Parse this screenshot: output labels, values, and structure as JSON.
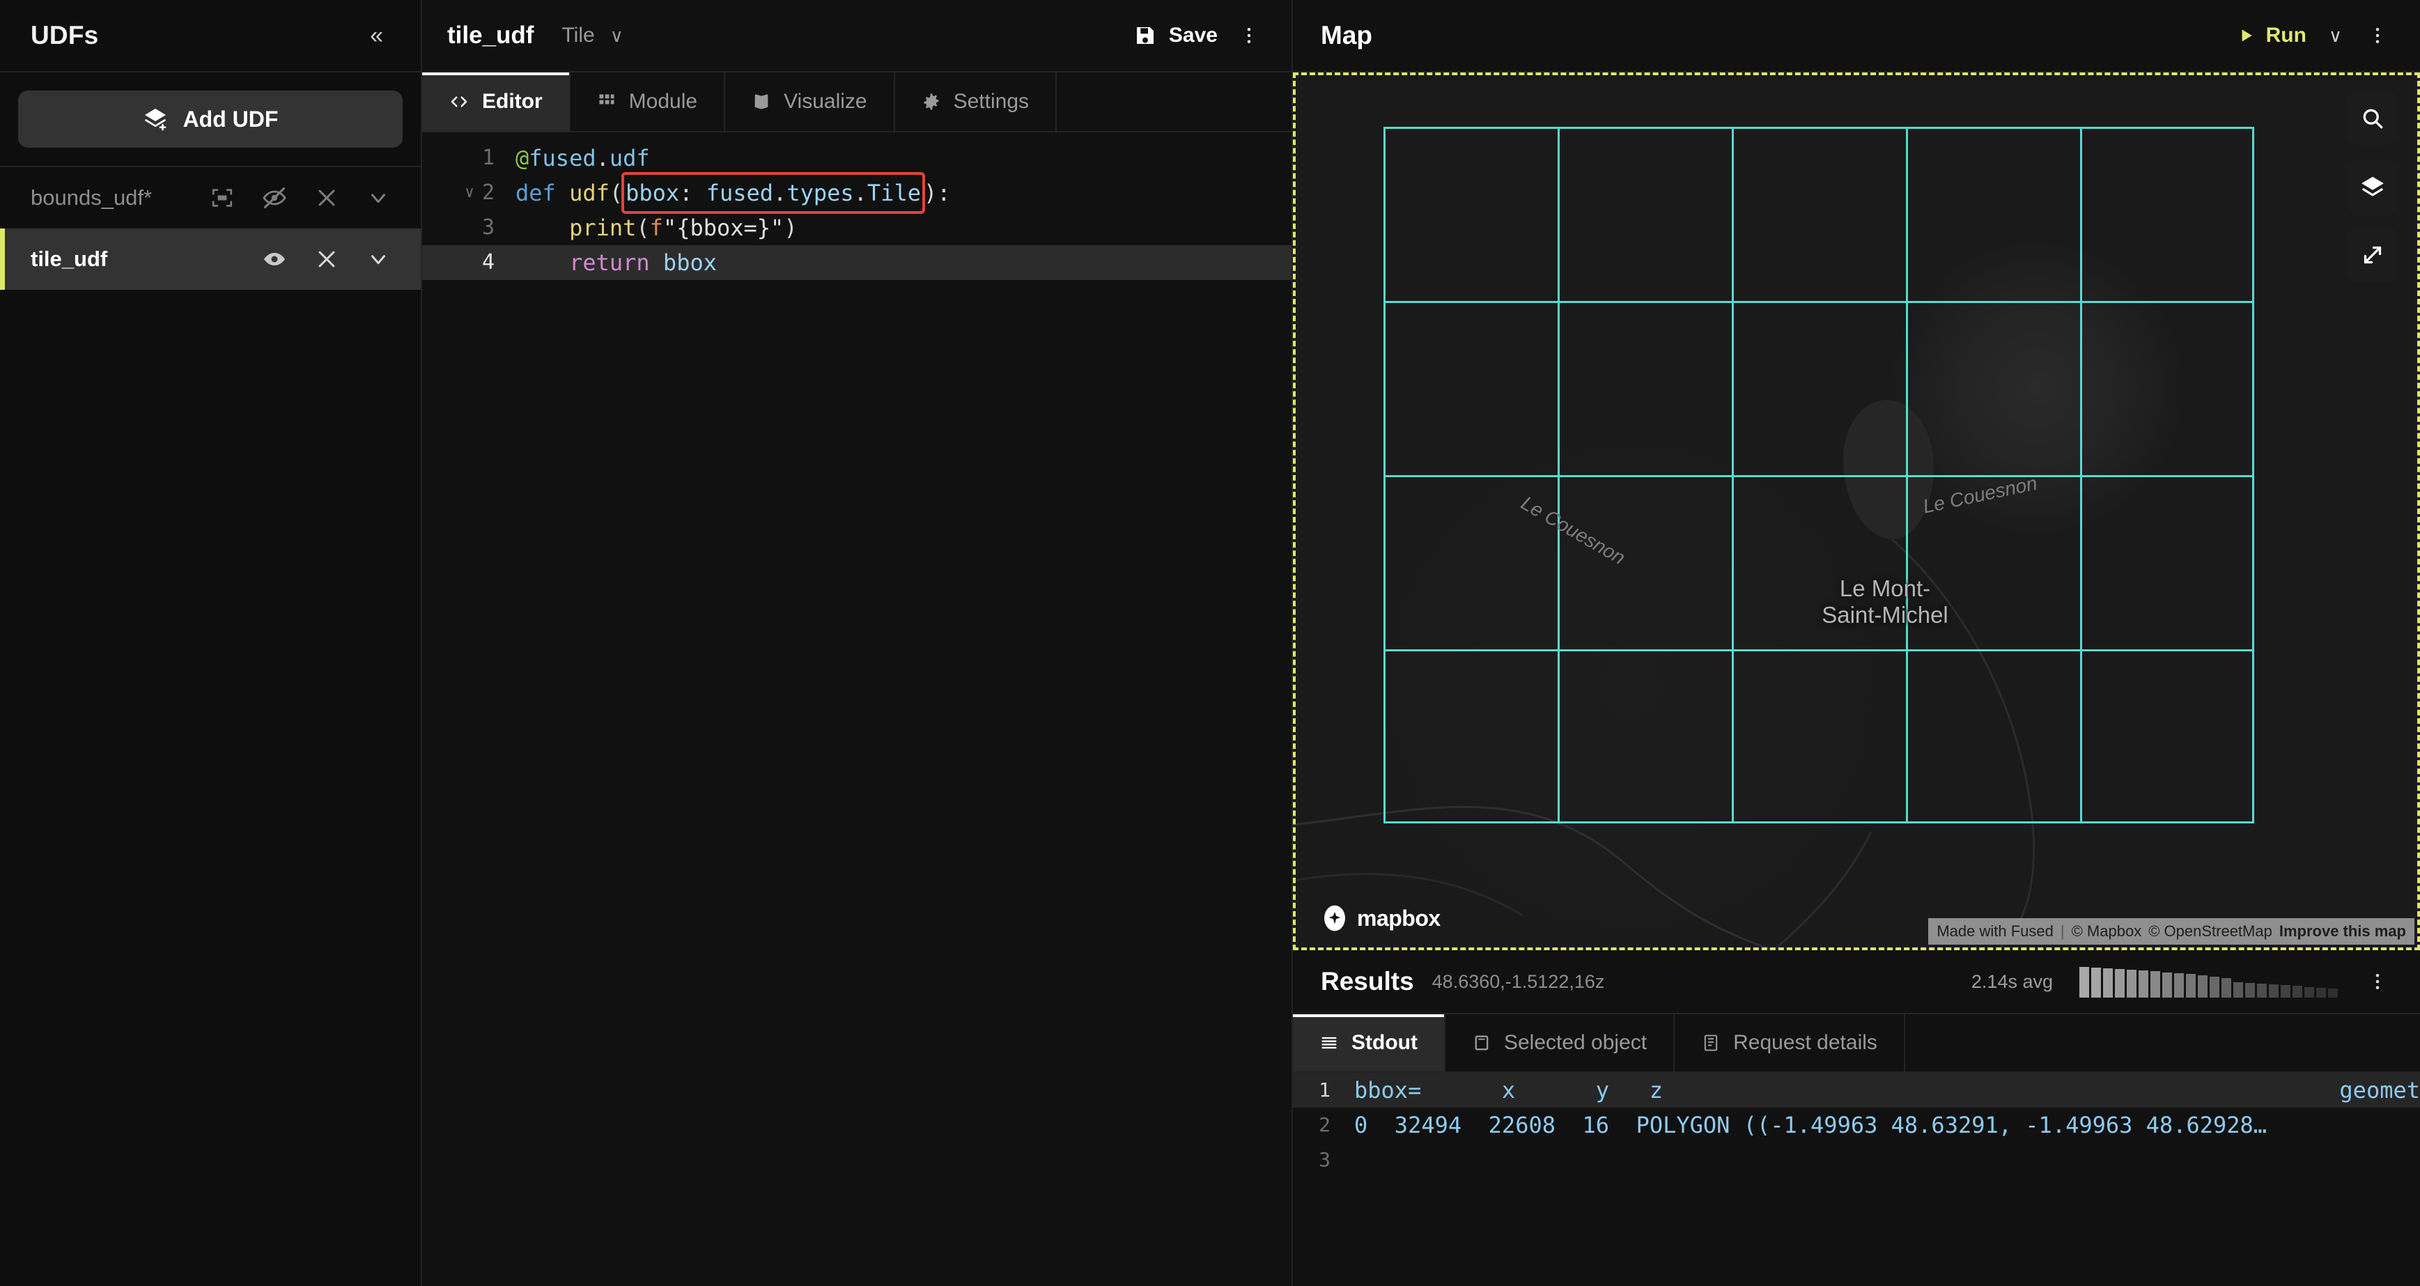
{
  "sidebar": {
    "title": "UDFs",
    "collapse_label": "«",
    "add_button_label": "Add UDF",
    "items": [
      {
        "name": "bounds_udf*",
        "active": false,
        "icons": [
          "zoom-to-bounds-icon",
          "eye-off-icon",
          "close-icon",
          "chevron-down-icon"
        ]
      },
      {
        "name": "tile_udf",
        "active": true,
        "icons": [
          "eye-icon",
          "close-icon",
          "chevron-down-icon"
        ]
      }
    ]
  },
  "editor": {
    "file_name": "tile_udf",
    "file_type": "Tile",
    "file_type_caret": "∨",
    "save_label": "Save",
    "menu_label": "⋮",
    "tabs": [
      {
        "label": "Editor",
        "icon": "code-icon",
        "active": true
      },
      {
        "label": "Module",
        "icon": "grid-icon",
        "active": false
      },
      {
        "label": "Visualize",
        "icon": "chart-icon",
        "active": false
      },
      {
        "label": "Settings",
        "icon": "gear-icon",
        "active": false
      }
    ],
    "code_lines": [
      {
        "num": "1",
        "fold": "",
        "active": false,
        "text": "@fused.udf"
      },
      {
        "num": "2",
        "fold": "∨",
        "active": false,
        "text": "def udf(bbox: fused.types.Tile):"
      },
      {
        "num": "3",
        "fold": "",
        "active": false,
        "text": "    print(f\"{bbox=}\")"
      },
      {
        "num": "4",
        "fold": "",
        "active": true,
        "text": "    return bbox"
      }
    ],
    "highlighted_token": "bbox: fused.types.Tile",
    "highlight_color": "#e8413c"
  },
  "map": {
    "title": "Map",
    "run_label": "Run",
    "run_color": "#dfe96a",
    "run_caret": "∨",
    "menu_label": "⋮",
    "controls": [
      {
        "name": "search-icon"
      },
      {
        "name": "layers-icon"
      },
      {
        "name": "expand-icon"
      }
    ],
    "labels": [
      {
        "text": "Le Couesnon",
        "type": "river"
      },
      {
        "text": "Le Couesnon",
        "type": "river"
      },
      {
        "text": "Le Mont-\nSaint-Michel",
        "type": "place"
      }
    ],
    "label_place_line1": "Le Mont-",
    "label_place_line2": "Saint-Michel",
    "label_river_1": "Le Couesnon",
    "label_river_2": "Le Couesnon",
    "logo_text": "mapbox",
    "attribution": {
      "made_with": "Made with Fused",
      "separator": "|",
      "mapbox": "© Mapbox",
      "osm": "© OpenStreetMap",
      "improve": "Improve this map"
    },
    "tile_grid_color": "#5ad9d0",
    "boundary_color": "#dfe96a"
  },
  "results": {
    "title": "Results",
    "coordinates": "48.6360,-1.5122,16z",
    "timing": "2.14s avg",
    "menu_label": "⋮",
    "sparkline_values": [
      44,
      43,
      42,
      41,
      40,
      39,
      38,
      36,
      35,
      34,
      32,
      30,
      28,
      22,
      21,
      20,
      19,
      18,
      17,
      15,
      14,
      13
    ],
    "tabs": [
      {
        "label": "Stdout",
        "icon": "list-icon",
        "active": true
      },
      {
        "label": "Selected object",
        "icon": "square-icon",
        "active": false
      },
      {
        "label": "Request details",
        "icon": "details-icon",
        "active": false
      }
    ],
    "stdout_lines": [
      {
        "num": "1",
        "header": true,
        "text": "bbox=      x      y   z",
        "right": "geomet"
      },
      {
        "num": "2",
        "header": false,
        "text": "0  32494  22608  16  POLYGON ((-1.49963 48.63291, -1.49963 48.62928…",
        "right": ""
      },
      {
        "num": "3",
        "header": false,
        "text": "",
        "right": ""
      }
    ]
  }
}
